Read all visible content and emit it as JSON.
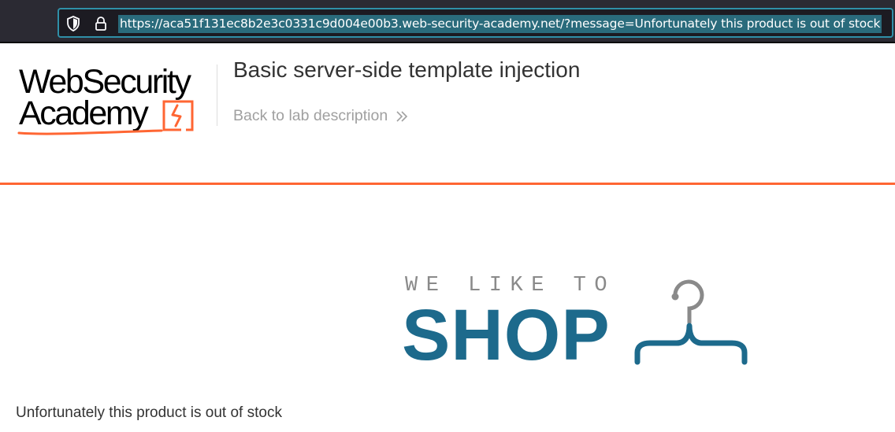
{
  "browser": {
    "url": "https://aca51f131ec8b2e3c0331c9d004e00b3.web-security-academy.net/?message=Unfortunately this product is out of stock",
    "icons": {
      "shield": "shield-icon",
      "lock": "lock-icon"
    },
    "url_highlight_color": "#2a6b7c",
    "focus_border_color": "#2f8fa8"
  },
  "lab_header": {
    "logo": {
      "line1": "WebSecurity",
      "line2": "Academy"
    },
    "title": "Basic server-side template injection",
    "back_link": "Back to lab description",
    "back_icon": "double-chevron-right-icon",
    "accent_color": "#ff6633"
  },
  "shop": {
    "tagline": "WE LIKE TO",
    "brand": "SHOP",
    "icon": "hanger-icon",
    "brand_color": "#1d6a8c"
  },
  "message": "Unfortunately this product is out of stock"
}
